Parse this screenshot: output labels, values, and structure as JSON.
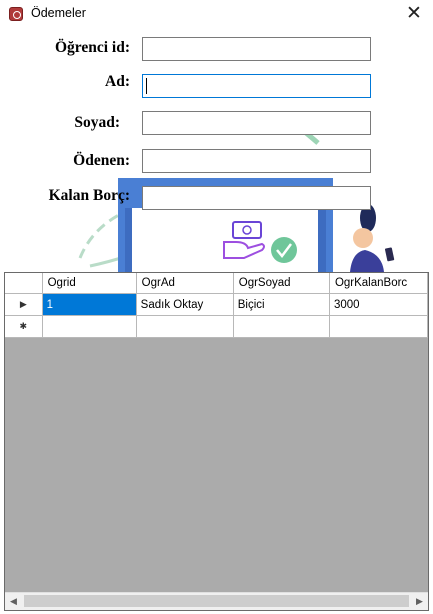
{
  "window": {
    "title": "Ödemeler"
  },
  "form": {
    "labels": {
      "ogrenci_id": "Öğrenci id:",
      "ad": "Ad:",
      "soyad": "Soyad:",
      "odenen": "Ödenen:",
      "kalan_borc": "Kalan Borç:"
    },
    "values": {
      "ogrenci_id": "",
      "ad": "",
      "soyad": "",
      "odenen": "",
      "kalan_borc": ""
    }
  },
  "grid": {
    "columns": [
      "Ogrid",
      "OgrAd",
      "OgrSoyad",
      "OgrKalanBorc"
    ],
    "rows": [
      {
        "marker": "▶",
        "cells": [
          "1",
          "Sadık Oktay",
          "Biçici",
          "3000"
        ]
      }
    ],
    "new_row_marker": "✱"
  },
  "colors": {
    "selection": "#0078d7",
    "grid_background": "#ababab",
    "focus_border": "#0078d7"
  }
}
